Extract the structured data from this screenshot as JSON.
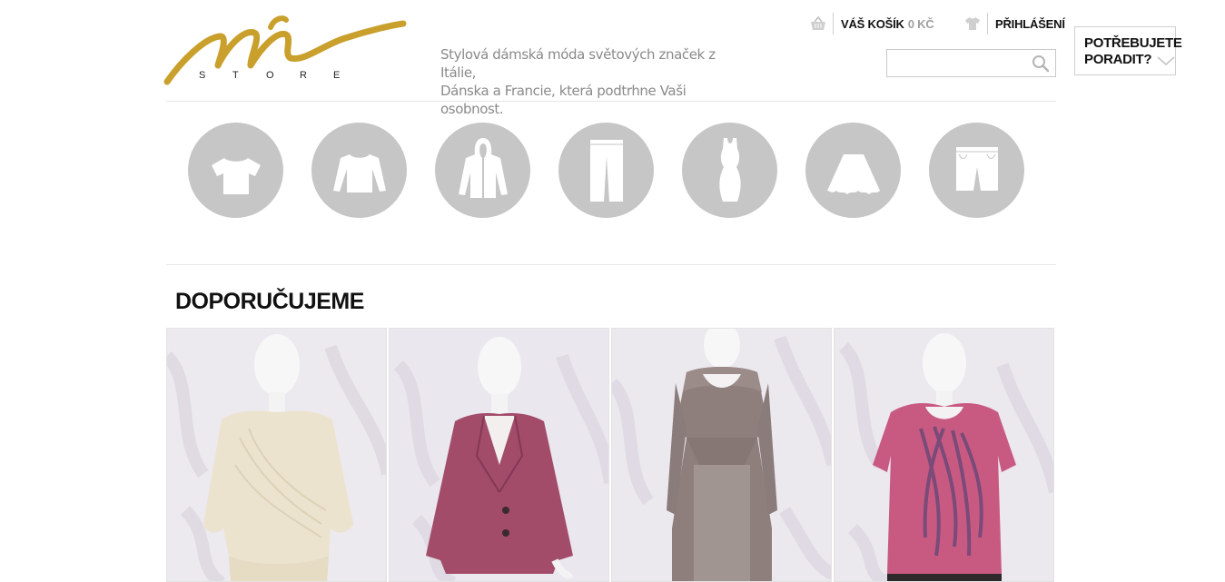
{
  "header": {
    "logo_letters": [
      "S",
      "T",
      "O",
      "R",
      "E"
    ],
    "tagline_line1": "Stylová dámská móda světových značek z Itálie,",
    "tagline_line2": "Dánska a Francie, která podtrhne Vaši osobnost.",
    "cart_label": "VÁŠ KOŠÍK",
    "cart_amount": "0 KČ",
    "login_label": "PŘIHLÁŠENÍ",
    "search_placeholder": "",
    "help_line1": "POTŘEBUJETE",
    "help_line2": "PORADIT?"
  },
  "categories": [
    {
      "icon": "tshirt-icon"
    },
    {
      "icon": "sweater-icon"
    },
    {
      "icon": "hoodie-icon"
    },
    {
      "icon": "trousers-icon"
    },
    {
      "icon": "dress-icon"
    },
    {
      "icon": "skirt-icon"
    },
    {
      "icon": "shorts-icon"
    }
  ],
  "recommend": {
    "title": "DOPORUČUJEME",
    "products": [
      {
        "image": "cream-blouse-on-mannequin"
      },
      {
        "image": "pink-blazer-on-mannequin"
      },
      {
        "image": "grey-knit-dress-on-mannequin"
      },
      {
        "image": "pink-print-tshirt-on-mannequin"
      }
    ]
  },
  "colors": {
    "logo_gold": "#c9a02c",
    "category_circle": "#c6c6c6",
    "text_muted": "#8a8a8a"
  }
}
